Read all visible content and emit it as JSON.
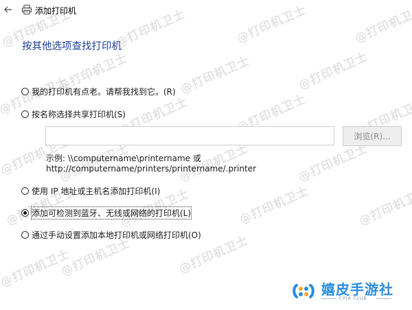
{
  "window": {
    "title": "添加打印机"
  },
  "heading": "按其他选项查找打印机",
  "options": [
    {
      "label": "我的打印机有点老。请帮我找到它。(R)",
      "selected": false
    },
    {
      "label": "按名称选择共享打印机(S)",
      "selected": false
    },
    {
      "label": "使用 IP 地址或主机名添加打印机(I)",
      "selected": false
    },
    {
      "label": "添加可检测到蓝牙、无线或网络的打印机(L)",
      "selected": true
    },
    {
      "label": "通过手动设置添加本地打印机或网络打印机(O)",
      "selected": false
    }
  ],
  "share_input": {
    "value": ""
  },
  "browse_label": "浏览(R)...",
  "example_lines": [
    "示例: \\\\computername\\printername 或",
    "http://computername/printers/printername/.printer"
  ],
  "watermark": "@打印机卫士",
  "logo": {
    "name": "嬉皮手游社",
    "sub": "CPIA CLUB",
    "colors": {
      "blue": "#2a8de0",
      "orange": "#f5a623"
    }
  },
  "icons": {
    "back": "back-arrow-icon",
    "printer": "printer-icon",
    "logo": "logo-mark-icon"
  },
  "colors": {
    "heading": "#1e3f9a",
    "background": "#ffffff",
    "disabled_text": "#8a8a8a"
  }
}
